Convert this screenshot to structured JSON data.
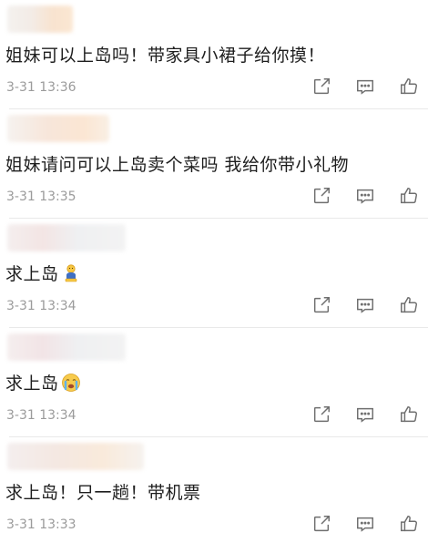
{
  "comments": [
    {
      "text": "姐妹可以上岛吗！带家具小裙子给你摸！",
      "time": "3-31 13:36",
      "emoji": ""
    },
    {
      "text": "姐妹请问可以上岛卖个菜吗 我给你带小礼物",
      "time": "3-31 13:35",
      "emoji": ""
    },
    {
      "text": "求上岛",
      "time": "3-31 13:34",
      "emoji": "kneeling-emoji"
    },
    {
      "text": "求上岛",
      "time": "3-31 13:34",
      "emoji": "crying-emoji"
    },
    {
      "text": "求上岛！只一趟！带机票",
      "time": "3-31 13:33",
      "emoji": ""
    }
  ],
  "icons": {
    "share": "share-icon",
    "reply": "comment-icon",
    "like": "thumbs-up-icon"
  },
  "colors": {
    "text": "#1e1e1e",
    "meta": "#9b9b9b",
    "icon": "#6f6f6f",
    "divider": "#e9e9e9"
  }
}
